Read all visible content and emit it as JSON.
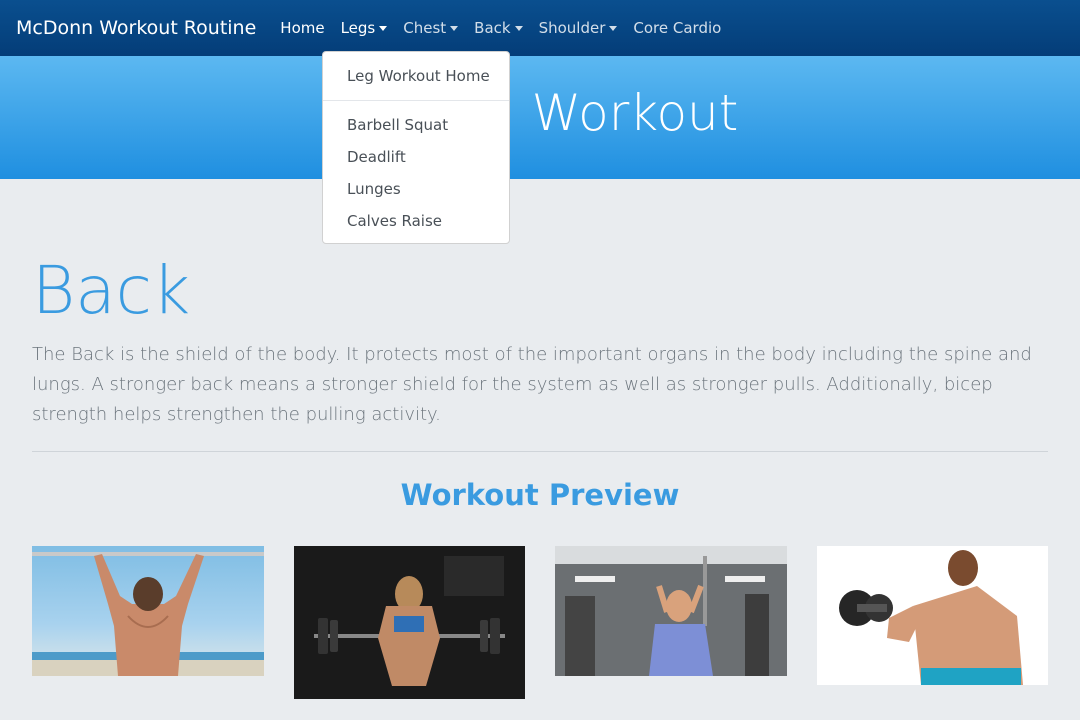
{
  "navbar": {
    "brand": "McDonn Workout Routine",
    "items": [
      {
        "label": "Home",
        "has_caret": false
      },
      {
        "label": "Legs",
        "has_caret": true
      },
      {
        "label": "Chest",
        "has_caret": true
      },
      {
        "label": "Back",
        "has_caret": true
      },
      {
        "label": "Shoulder",
        "has_caret": true
      },
      {
        "label": "Core Cardio",
        "has_caret": false
      }
    ]
  },
  "dropdown": {
    "items": [
      "Leg Workout Home",
      "Barbell Squat",
      "Deadlift",
      "Lunges",
      "Calves Raise"
    ]
  },
  "hero": {
    "title": "Workout"
  },
  "section": {
    "title": "Back",
    "description": "The Back is the shield of the body. It protects most of the important organs in the body including the spine and lungs. A stronger back means a stronger shield for the system as well as stronger pulls. Additionally, bicep strength helps strengthen the pulling activity."
  },
  "preview": {
    "title": "Workout Preview",
    "images": [
      "pull-up-beach-photo",
      "barbell-deadlift-photo",
      "cable-pulldown-gym-photo",
      "dumbbell-curl-photo"
    ]
  },
  "colors": {
    "navbar": "#043d78",
    "hero": "#2e9ae6",
    "accent": "#3a9be0",
    "background": "#e9ecef"
  }
}
